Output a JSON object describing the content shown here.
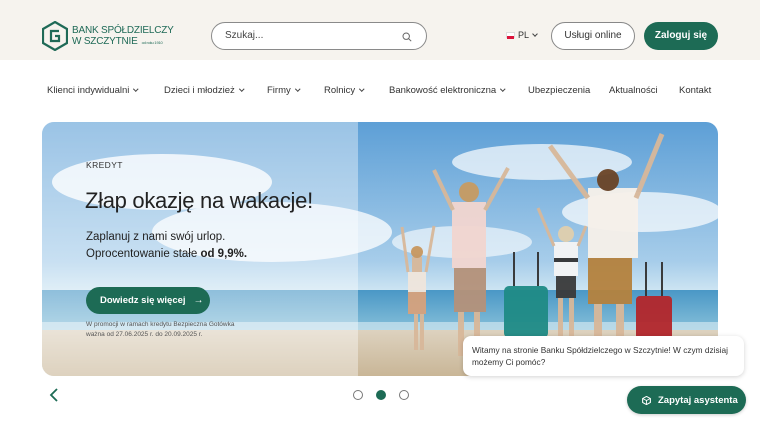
{
  "header": {
    "logo": {
      "line1": "BANK SPÓŁDZIELCZY",
      "line2": "W SZCZYTNIE",
      "since": "od roku 1910"
    },
    "search": {
      "placeholder": "Szukaj..."
    },
    "language": {
      "code": "PL",
      "flag_colors": [
        "#ffffff",
        "#dc143c"
      ]
    },
    "online_services_label": "Usługi online",
    "login_label": "Zaloguj się"
  },
  "nav": {
    "items": [
      {
        "label": "Klienci indywidualni",
        "has_dropdown": true
      },
      {
        "label": "Dzieci i młodzież",
        "has_dropdown": true
      },
      {
        "label": "Firmy",
        "has_dropdown": true
      },
      {
        "label": "Rolnicy",
        "has_dropdown": true
      },
      {
        "label": "Bankowość elektroniczna",
        "has_dropdown": true
      },
      {
        "label": "Ubezpieczenia",
        "has_dropdown": false
      },
      {
        "label": "Aktualności",
        "has_dropdown": false
      },
      {
        "label": "Kontakt",
        "has_dropdown": false
      }
    ]
  },
  "hero": {
    "tag": "KREDYT",
    "title": "Złap okazję na wakacje!",
    "subtitle_line1": "Zaplanuj z nami swój urlop.",
    "subtitle_line2_prefix": "Oprocentowanie stałe ",
    "subtitle_line2_bold": "od 9,9%.",
    "cta_label": "Dowiedz się więcej",
    "promo_line1": "W promocji w ramach kredytu Bezpieczna Gotówka",
    "promo_line2": "ważna od 27.06.2025 r. do 20.09.2025 r."
  },
  "carousel": {
    "slide_count": 3,
    "active_index": 1
  },
  "chat": {
    "greeting": "Witamy na stronie Banku Spółdzielczego w Szczytnie! W czym dzisiaj możemy Ci pomóc?",
    "assistant_label": "Zapytaj asystenta"
  },
  "colors": {
    "brand_green": "#1d6b55",
    "top_bar": "#f6f3ee"
  }
}
